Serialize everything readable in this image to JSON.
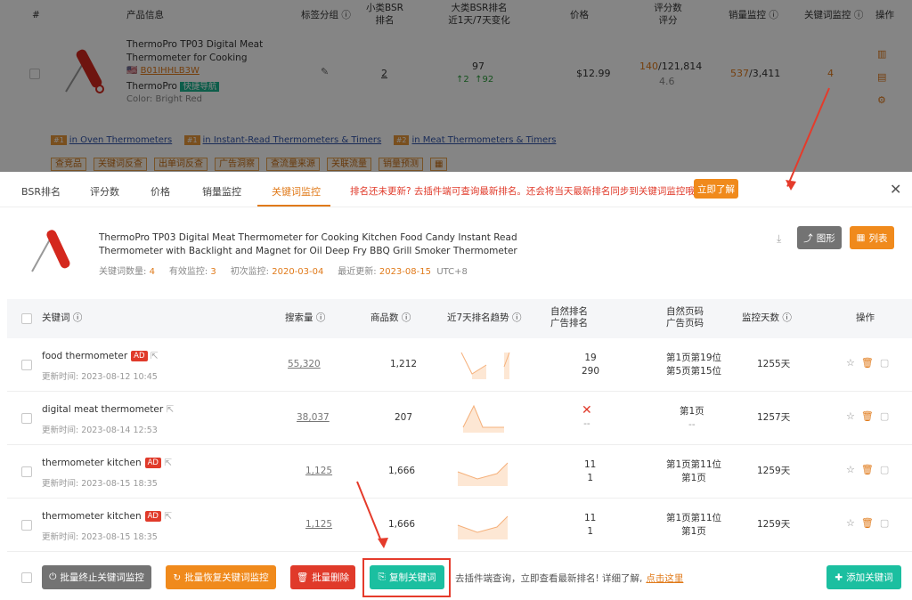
{
  "header": {
    "col_index": "#",
    "col_product": "产品信息",
    "col_tag_group": "标签分组",
    "col_sub_bsr": "小类BSR\n排名",
    "col_big_bsr": "大类BSR排名\n近1天/7天变化",
    "col_price": "价格",
    "col_ratings": "评分数\n评分",
    "col_sales": "销量监控",
    "col_kw_monitor": "关键词监控",
    "col_ops": "操作"
  },
  "product_row": {
    "title_line1": "ThermoPro TP03 Digital Meat",
    "title_line2": "Thermometer for Cooking",
    "asin": "B01IHHLB3W",
    "brand": "ThermoPro",
    "quick_nav": "快捷导航",
    "color": "Color: Bright Red",
    "sub_bsr": "2",
    "big_bsr": "97",
    "change_1d": "2",
    "change_7d": "92",
    "price": "$12.99",
    "ratings_new": "140",
    "ratings_total": "/121,814",
    "rating_score": "4.6",
    "sales_a": "537",
    "sales_b": "/3,411",
    "kw_count": "4",
    "ranks": [
      {
        "badge": "#1",
        "text": "in Oven Thermometers"
      },
      {
        "badge": "#1",
        "text": "in Instant-Read Thermometers & Timers"
      },
      {
        "badge": "#2",
        "text": "in Meat Thermometers & Timers"
      }
    ],
    "tags": [
      "查竞品",
      "关键词反查",
      "出单词反查",
      "广告洞察",
      "查流量来源",
      "关联流量",
      "销量预测"
    ]
  },
  "modal": {
    "tabs": [
      "BSR排名",
      "评分数",
      "价格",
      "销量监控",
      "关键词监控"
    ],
    "notice": "排名还未更新? 去插件端可查询最新排名。还会将当天最新排名同步到关键词监控哦~",
    "learn_btn": "立即了解",
    "product_title_line1": "ThermoPro TP03 Digital Meat Thermometer for Cooking Kitchen Food Candy Instant Read",
    "product_title_line2": "Thermometer with Backlight and Magnet for Oil Deep Fry BBQ Grill Smoker Thermometer",
    "stat_kw_label": "关键词数量:",
    "stat_kw_value": "4",
    "stat_valid_label": "有效监控:",
    "stat_valid_value": "3",
    "stat_first_label": "初次监控:",
    "stat_first_value": "2020-03-04",
    "stat_update_label": "最近更新:",
    "stat_update_value": "2023-08-15",
    "stat_tz": "UTC+8",
    "btn_chart": "图形",
    "btn_list": "列表"
  },
  "table": {
    "headers": {
      "keyword": "关键词",
      "search_volume": "搜索量",
      "product_count": "商品数",
      "trend": "近7天排名趋势",
      "natural_rank_l1": "自然排名",
      "natural_rank_l2": "广告排名",
      "page_l1": "自然页码",
      "page_l2": "广告页码",
      "days": "监控天数",
      "ops": "操作"
    },
    "rows": [
      {
        "keyword": "food thermometer",
        "ad": "AD",
        "updated": "更新时间: 2023-08-12 10:45",
        "volume": "55,320",
        "products": "1,212",
        "rank1": "19",
        "rank2": "290",
        "page1": "第1页第19位",
        "page2": "第5页第15位",
        "days": "1255天"
      },
      {
        "keyword": "digital meat thermometer",
        "ad": "",
        "updated": "更新时间: 2023-08-14 12:53",
        "volume": "38,037",
        "products": "207",
        "rank1": "✕",
        "rank2": "--",
        "page1": "第1页",
        "page2": "--",
        "days": "1257天"
      },
      {
        "keyword": "thermometer kitchen",
        "ad": "AD",
        "updated": "更新时间: 2023-08-15 18:35",
        "volume": "1,125",
        "products": "1,666",
        "rank1": "11",
        "rank2": "1",
        "page1": "第1页第11位",
        "page2": "第1页",
        "days": "1259天"
      },
      {
        "keyword": "thermometer kitchen",
        "ad": "AD",
        "updated": "更新时间: 2023-08-15 18:35",
        "volume": "1,125",
        "products": "1,666",
        "rank1": "11",
        "rank2": "1",
        "page1": "第1页第11位",
        "page2": "第1页",
        "days": "1259天"
      }
    ]
  },
  "footer": {
    "btn_stop": "批量终止关键词监控",
    "btn_resume": "批量恢复关键词监控",
    "btn_delete": "批量删除",
    "btn_copy": "复制关键词",
    "hint": "去插件端查询，立即查看最新排名! 详细了解,",
    "hint_link": "点击这里",
    "btn_add": "添加关键词"
  },
  "colors": {
    "orange": "#f08a1c",
    "teal": "#1bbfa0",
    "red": "#e03a2a",
    "gray": "#737373"
  }
}
